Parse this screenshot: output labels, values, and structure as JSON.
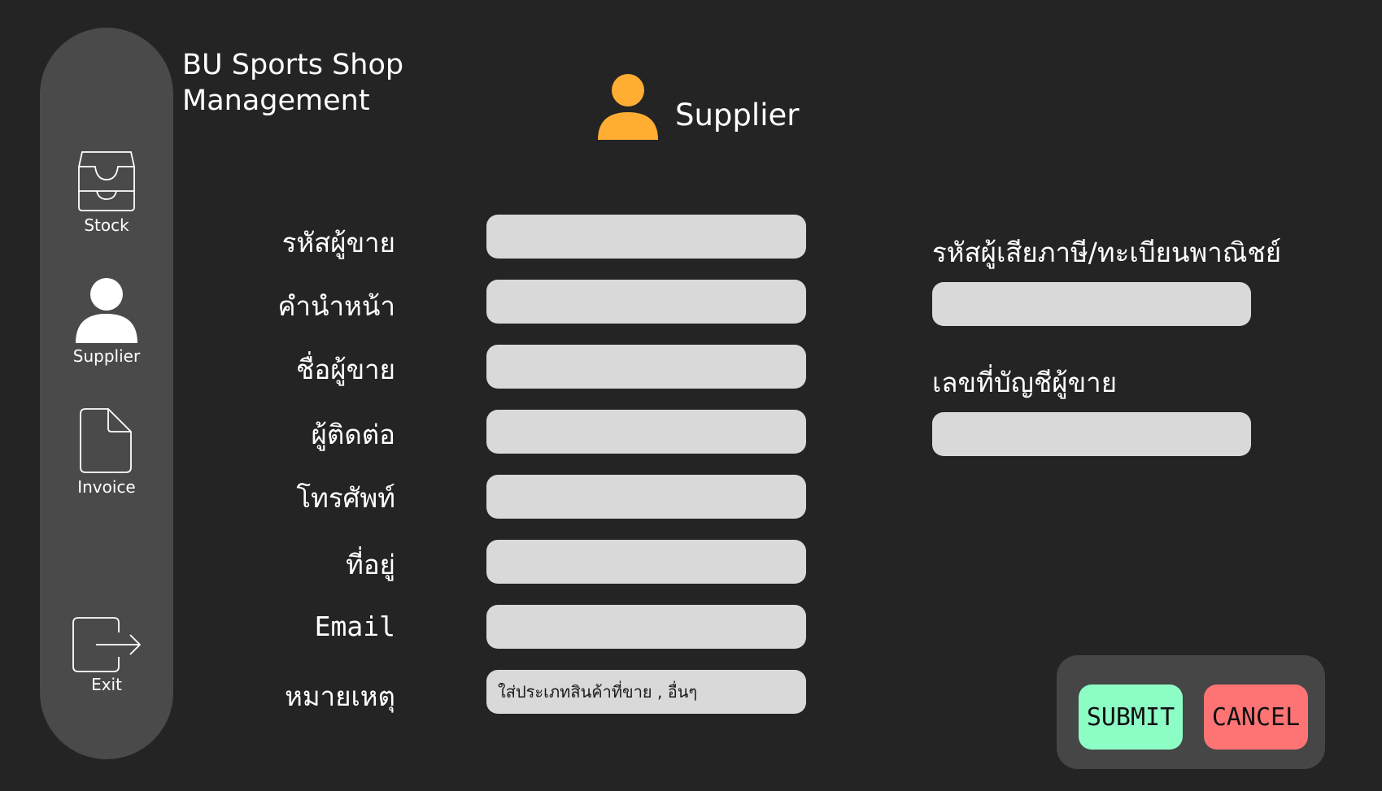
{
  "app": {
    "title_line1": "BU Sports Shop",
    "title_line2": "Management"
  },
  "sidebar": {
    "items": [
      {
        "label": "Stock",
        "icon": "inbox-tray-icon"
      },
      {
        "label": "Supplier",
        "icon": "person-icon"
      },
      {
        "label": "Invoice",
        "icon": "document-icon"
      },
      {
        "label": "Exit",
        "icon": "exit-icon"
      }
    ]
  },
  "page": {
    "title": "Supplier",
    "icon": "person-icon"
  },
  "form": {
    "fields": [
      {
        "label": "รหัสผู้ขาย",
        "value": "",
        "placeholder": ""
      },
      {
        "label": "คำนำหน้า",
        "value": "",
        "placeholder": ""
      },
      {
        "label": "ชื่อผู้ขาย",
        "value": "",
        "placeholder": ""
      },
      {
        "label": "ผู้ติดต่อ",
        "value": "",
        "placeholder": ""
      },
      {
        "label": "โทรศัพท์",
        "value": "",
        "placeholder": ""
      },
      {
        "label": "ที่อยู่",
        "value": "",
        "placeholder": ""
      },
      {
        "label": "Email",
        "value": "",
        "placeholder": ""
      },
      {
        "label": "หมายเหตุ",
        "value": "",
        "placeholder": "ใส่ประเภทสินค้าที่ขาย , อื่นๆ"
      }
    ],
    "right_fields": [
      {
        "label": "รหัสผู้เสียภาษี/ทะเบียนพาณิชย์",
        "value": ""
      },
      {
        "label": "เลขที่บัญชีผู้ขาย",
        "value": ""
      }
    ]
  },
  "actions": {
    "submit_label": "SUBMIT",
    "cancel_label": "CANCEL"
  },
  "colors": {
    "background": "#242424",
    "sidebar": "#4a4a4a",
    "accent_person": "#ffad33",
    "input_bg": "#d9d9d9",
    "submit_bg": "#8dfdc6",
    "cancel_bg": "#fe7474",
    "panel_bg": "#464646"
  }
}
